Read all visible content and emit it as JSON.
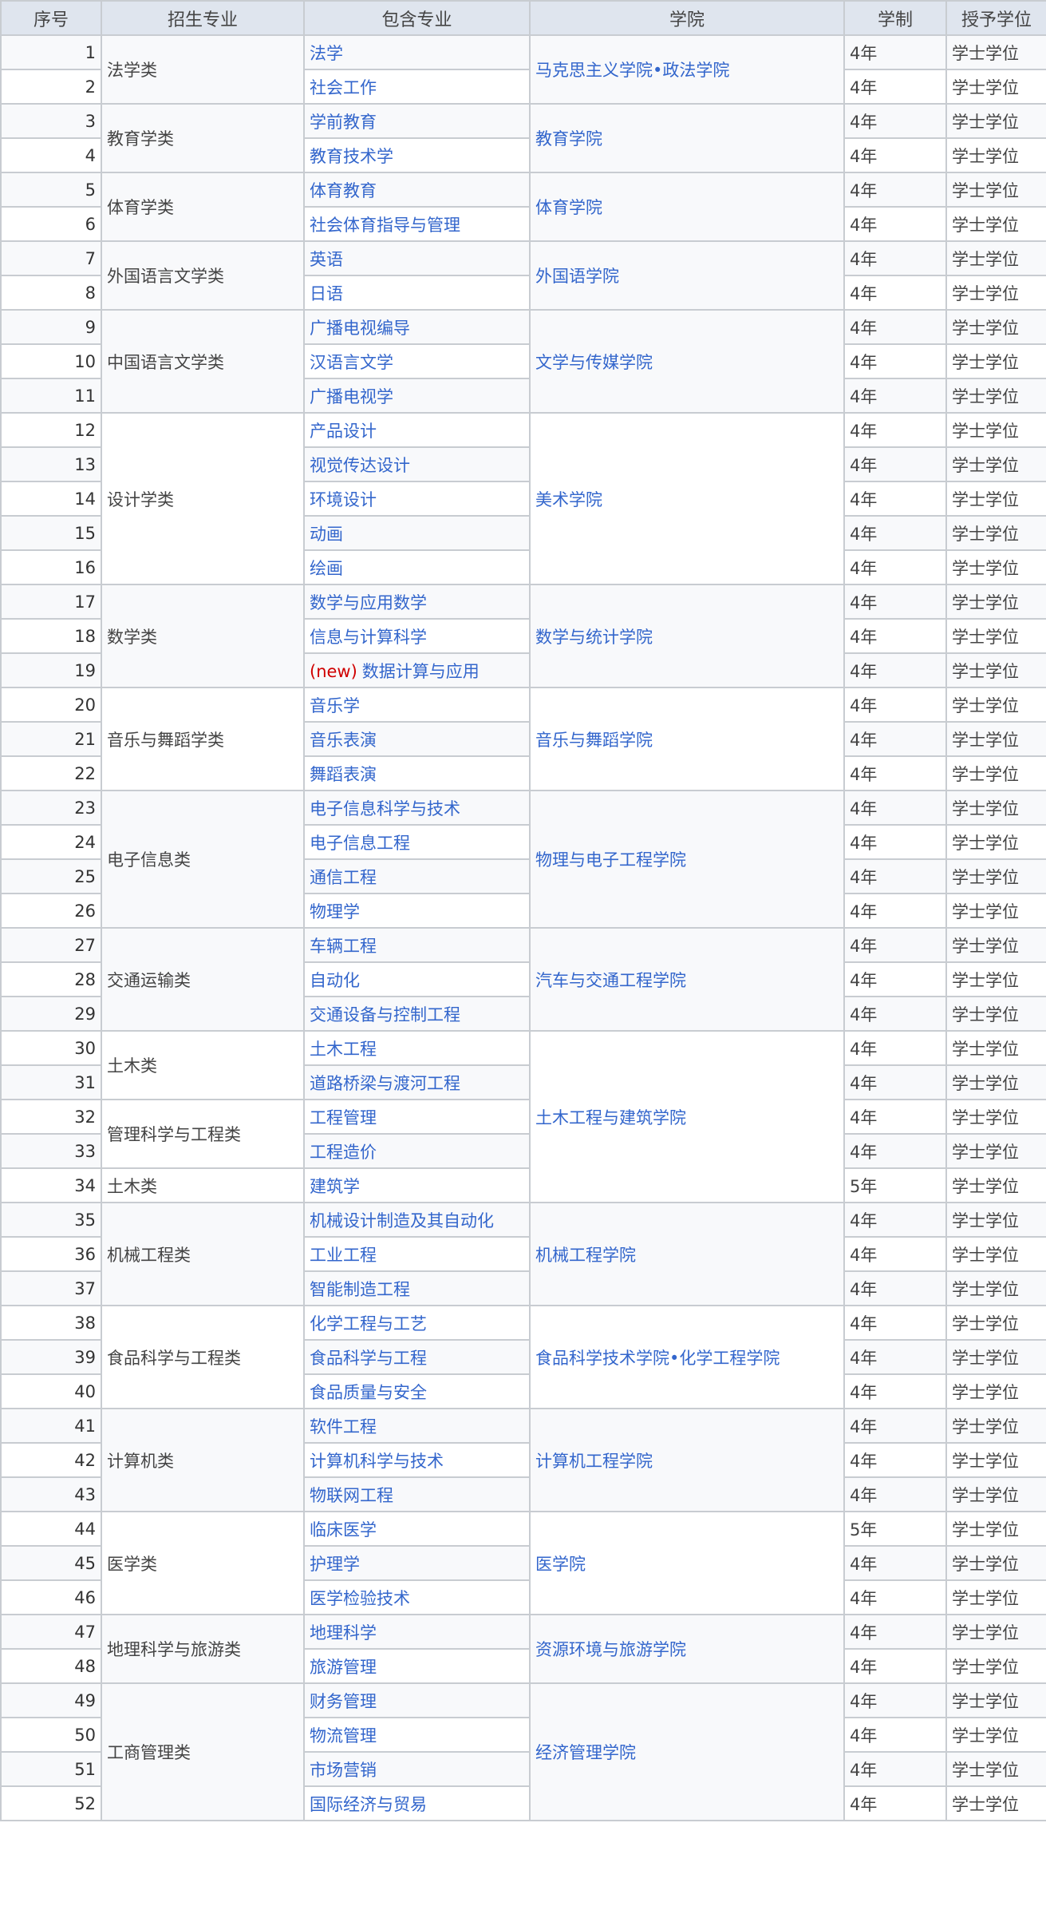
{
  "headers": [
    "序号",
    "招生专业",
    "包含专业",
    "学院",
    "学制",
    "授予学位"
  ],
  "new_tag": "(new)",
  "categories": [
    {
      "name": "法学类",
      "span": 2
    },
    {
      "name": "教育学类",
      "span": 2
    },
    {
      "name": "体育学类",
      "span": 2
    },
    {
      "name": "外国语言文学类",
      "span": 2
    },
    {
      "name": "中国语言文学类",
      "span": 3
    },
    {
      "name": "设计学类",
      "span": 5
    },
    {
      "name": "数学类",
      "span": 3
    },
    {
      "name": "音乐与舞蹈学类",
      "span": 3
    },
    {
      "name": "电子信息类",
      "span": 4
    },
    {
      "name": "交通运输类",
      "span": 3
    },
    {
      "name": "土木类",
      "span": 2
    },
    {
      "name": "管理科学与工程类",
      "span": 2
    },
    {
      "name": "土木类",
      "span": 1
    },
    {
      "name": "机械工程类",
      "span": 3
    },
    {
      "name": "食品科学与工程类",
      "span": 3
    },
    {
      "name": "计算机类",
      "span": 3
    },
    {
      "name": "医学类",
      "span": 3
    },
    {
      "name": "地理科学与旅游类",
      "span": 2
    },
    {
      "name": "工商管理类",
      "span": 4
    }
  ],
  "colleges": [
    {
      "name": "马克思主义学院•政法学院",
      "span": 2
    },
    {
      "name": "教育学院",
      "span": 2
    },
    {
      "name": "体育学院",
      "span": 2
    },
    {
      "name": "外国语学院",
      "span": 2
    },
    {
      "name": "文学与传媒学院",
      "span": 3
    },
    {
      "name": "美术学院",
      "span": 5
    },
    {
      "name": "数学与统计学院",
      "span": 3
    },
    {
      "name": "音乐与舞蹈学院",
      "span": 3
    },
    {
      "name": "物理与电子工程学院",
      "span": 4
    },
    {
      "name": "汽车与交通工程学院",
      "span": 3
    },
    {
      "name": "土木工程与建筑学院",
      "span": 5
    },
    {
      "name": "机械工程学院",
      "span": 3
    },
    {
      "name": "食品科学技术学院•化学工程学院",
      "span": 3
    },
    {
      "name": "计算机工程学院",
      "span": 3
    },
    {
      "name": "医学院",
      "span": 3
    },
    {
      "name": "资源环境与旅游学院",
      "span": 2
    },
    {
      "name": "经济管理学院",
      "span": 4
    }
  ],
  "rows": [
    {
      "no": "1",
      "major": "法学",
      "years": "4年",
      "degree": "学士学位"
    },
    {
      "no": "2",
      "major": "社会工作",
      "years": "4年",
      "degree": "学士学位"
    },
    {
      "no": "3",
      "major": "学前教育",
      "years": "4年",
      "degree": "学士学位"
    },
    {
      "no": "4",
      "major": "教育技术学",
      "years": "4年",
      "degree": "学士学位"
    },
    {
      "no": "5",
      "major": "体育教育",
      "years": "4年",
      "degree": "学士学位"
    },
    {
      "no": "6",
      "major": "社会体育指导与管理",
      "years": "4年",
      "degree": "学士学位"
    },
    {
      "no": "7",
      "major": "英语",
      "years": "4年",
      "degree": "学士学位"
    },
    {
      "no": "8",
      "major": "日语",
      "years": "4年",
      "degree": "学士学位"
    },
    {
      "no": "9",
      "major": "广播电视编导",
      "years": "4年",
      "degree": "学士学位"
    },
    {
      "no": "10",
      "major": "汉语言文学",
      "years": "4年",
      "degree": "学士学位"
    },
    {
      "no": "11",
      "major": "广播电视学",
      "years": "4年",
      "degree": "学士学位"
    },
    {
      "no": "12",
      "major": "产品设计",
      "years": "4年",
      "degree": "学士学位"
    },
    {
      "no": "13",
      "major": "视觉传达设计",
      "years": "4年",
      "degree": "学士学位"
    },
    {
      "no": "14",
      "major": "环境设计",
      "years": "4年",
      "degree": "学士学位"
    },
    {
      "no": "15",
      "major": "动画",
      "years": "4年",
      "degree": "学士学位"
    },
    {
      "no": "16",
      "major": "绘画",
      "years": "4年",
      "degree": "学士学位"
    },
    {
      "no": "17",
      "major": "数学与应用数学",
      "years": "4年",
      "degree": "学士学位"
    },
    {
      "no": "18",
      "major": "信息与计算科学",
      "years": "4年",
      "degree": "学士学位"
    },
    {
      "no": "19",
      "major": "数据计算与应用",
      "is_new": true,
      "years": "4年",
      "degree": "学士学位"
    },
    {
      "no": "20",
      "major": "音乐学",
      "years": "4年",
      "degree": "学士学位"
    },
    {
      "no": "21",
      "major": "音乐表演",
      "years": "4年",
      "degree": "学士学位"
    },
    {
      "no": "22",
      "major": "舞蹈表演",
      "years": "4年",
      "degree": "学士学位"
    },
    {
      "no": "23",
      "major": "电子信息科学与技术",
      "years": "4年",
      "degree": "学士学位"
    },
    {
      "no": "24",
      "major": "电子信息工程",
      "years": "4年",
      "degree": "学士学位"
    },
    {
      "no": "25",
      "major": "通信工程",
      "years": "4年",
      "degree": "学士学位"
    },
    {
      "no": "26",
      "major": "物理学",
      "years": "4年",
      "degree": "学士学位"
    },
    {
      "no": "27",
      "major": "车辆工程",
      "years": "4年",
      "degree": "学士学位"
    },
    {
      "no": "28",
      "major": "自动化",
      "years": "4年",
      "degree": "学士学位"
    },
    {
      "no": "29",
      "major": "交通设备与控制工程",
      "years": "4年",
      "degree": "学士学位"
    },
    {
      "no": "30",
      "major": "土木工程",
      "years": "4年",
      "degree": "学士学位"
    },
    {
      "no": "31",
      "major": "道路桥梁与渡河工程",
      "years": "4年",
      "degree": "学士学位"
    },
    {
      "no": "32",
      "major": "工程管理",
      "years": "4年",
      "degree": "学士学位"
    },
    {
      "no": "33",
      "major": "工程造价",
      "years": "4年",
      "degree": "学士学位"
    },
    {
      "no": "34",
      "major": "建筑学",
      "years": "5年",
      "degree": "学士学位"
    },
    {
      "no": "35",
      "major": "机械设计制造及其自动化",
      "years": "4年",
      "degree": "学士学位"
    },
    {
      "no": "36",
      "major": "工业工程",
      "years": "4年",
      "degree": "学士学位"
    },
    {
      "no": "37",
      "major": "智能制造工程",
      "years": "4年",
      "degree": "学士学位"
    },
    {
      "no": "38",
      "major": "化学工程与工艺",
      "years": "4年",
      "degree": "学士学位"
    },
    {
      "no": "39",
      "major": "食品科学与工程",
      "years": "4年",
      "degree": "学士学位"
    },
    {
      "no": "40",
      "major": "食品质量与安全",
      "years": "4年",
      "degree": "学士学位"
    },
    {
      "no": "41",
      "major": "软件工程",
      "years": "4年",
      "degree": "学士学位"
    },
    {
      "no": "42",
      "major": "计算机科学与技术",
      "years": "4年",
      "degree": "学士学位"
    },
    {
      "no": "43",
      "major": "物联网工程",
      "years": "4年",
      "degree": "学士学位"
    },
    {
      "no": "44",
      "major": "临床医学",
      "years": "5年",
      "degree": "学士学位"
    },
    {
      "no": "45",
      "major": "护理学",
      "years": "4年",
      "degree": "学士学位"
    },
    {
      "no": "46",
      "major": "医学检验技术",
      "years": "4年",
      "degree": "学士学位"
    },
    {
      "no": "47",
      "major": "地理科学",
      "years": "4年",
      "degree": "学士学位"
    },
    {
      "no": "48",
      "major": "旅游管理",
      "years": "4年",
      "degree": "学士学位"
    },
    {
      "no": "49",
      "major": "财务管理",
      "years": "4年",
      "degree": "学士学位"
    },
    {
      "no": "50",
      "major": "物流管理",
      "years": "4年",
      "degree": "学士学位"
    },
    {
      "no": "51",
      "major": "市场营销",
      "years": "4年",
      "degree": "学士学位"
    },
    {
      "no": "52",
      "major": "国际经济与贸易",
      "years": "4年",
      "degree": "学士学位"
    }
  ]
}
